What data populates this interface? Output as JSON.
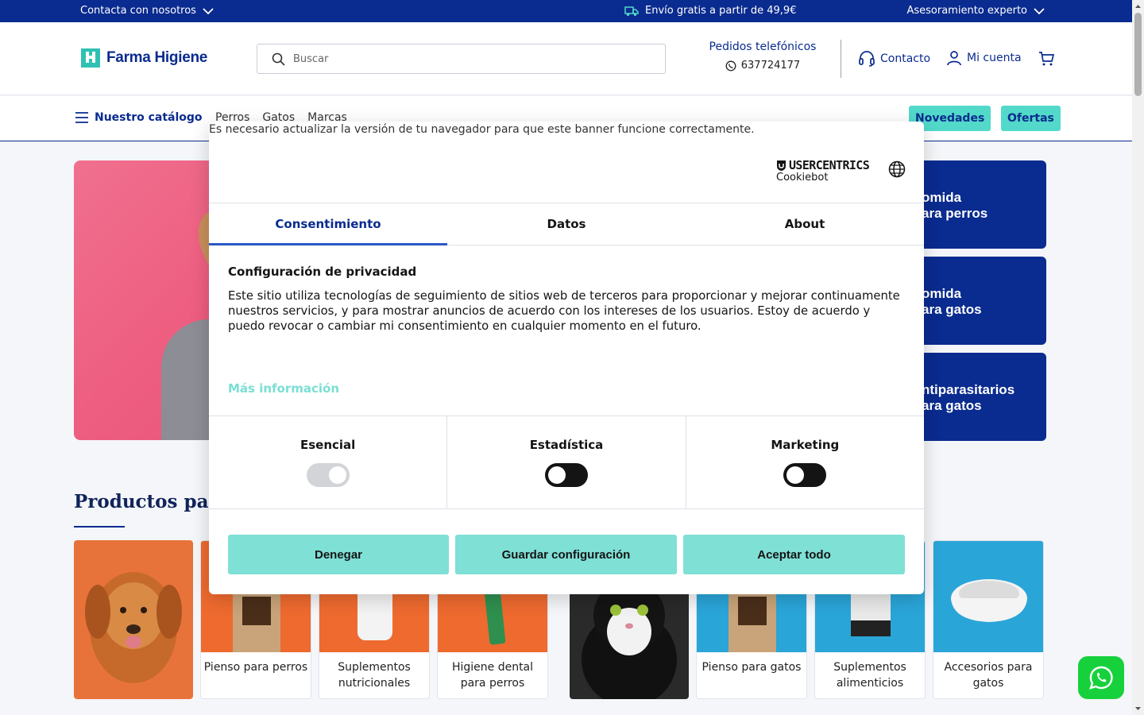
{
  "topbar": {
    "contact": "Contacta con nosotros",
    "shipping": "Envío gratis a partir de 49,9€",
    "advice": "Asesoramiento experto"
  },
  "header": {
    "logo_text": "Farma Higiene",
    "search_placeholder": "Buscar",
    "phone_title": "Pedidos telefónicos",
    "phone_number": "637724177",
    "contact_label": "Contacto",
    "account_label": "Mi cuenta"
  },
  "nav": {
    "catalog_label": "Nuestro catálogo",
    "links": [
      "Perros",
      "Gatos",
      "Marcas"
    ],
    "news_label": "Novedades",
    "offers_label": "Ofertas"
  },
  "hero": {
    "tiles": [
      {
        "line1": "omida",
        "line2": "ara perros"
      },
      {
        "line1": "omida",
        "line2": "ara gatos"
      },
      {
        "line1": "ntiparasitarios",
        "line2": "ara gatos"
      }
    ]
  },
  "products": {
    "title": "Productos para",
    "cards": [
      {
        "label": "Pienso para perros"
      },
      {
        "label": "Suplementos nutricionales"
      },
      {
        "label": "Higiene dental para perros"
      },
      {
        "label": "Pienso para gatos"
      },
      {
        "label": "Suplementos alimenticios"
      },
      {
        "label": "Accesorios para gatos"
      }
    ]
  },
  "cookie_dialog": {
    "warning": "Es necesario actualizar la versión de tu navegador para que este banner funcione correctamente.",
    "brand_line1": "USERCENTRICS",
    "brand_line2": "Cookiebot",
    "tabs": [
      "Consentimiento",
      "Datos",
      "About"
    ],
    "active_tab": "Consentimiento",
    "heading": "Configuración de privacidad",
    "body": "Este sitio utiliza tecnologías de seguimiento de sitios web de terceros para proporcionar y mejorar continuamente nuestros servicios, y para mostrar anuncios de acuerdo con los intereses de los usuarios. Estoy de acuerdo y puedo revocar o cambiar mi consentimiento en cualquier momento en el futuro.",
    "more_info": "Más información",
    "toggles": [
      {
        "label": "Esencial",
        "state": "on-disabled"
      },
      {
        "label": "Estadística",
        "state": "off"
      },
      {
        "label": "Marketing",
        "state": "off"
      }
    ],
    "buttons": {
      "deny": "Denegar",
      "save": "Guardar configuración",
      "accept_all": "Aceptar todo"
    }
  },
  "colors": {
    "brand_navy": "#0a2b8f",
    "accent_teal": "#52d9c9",
    "button_teal": "#7fe0d6",
    "whatsapp_green": "#17d13c"
  }
}
